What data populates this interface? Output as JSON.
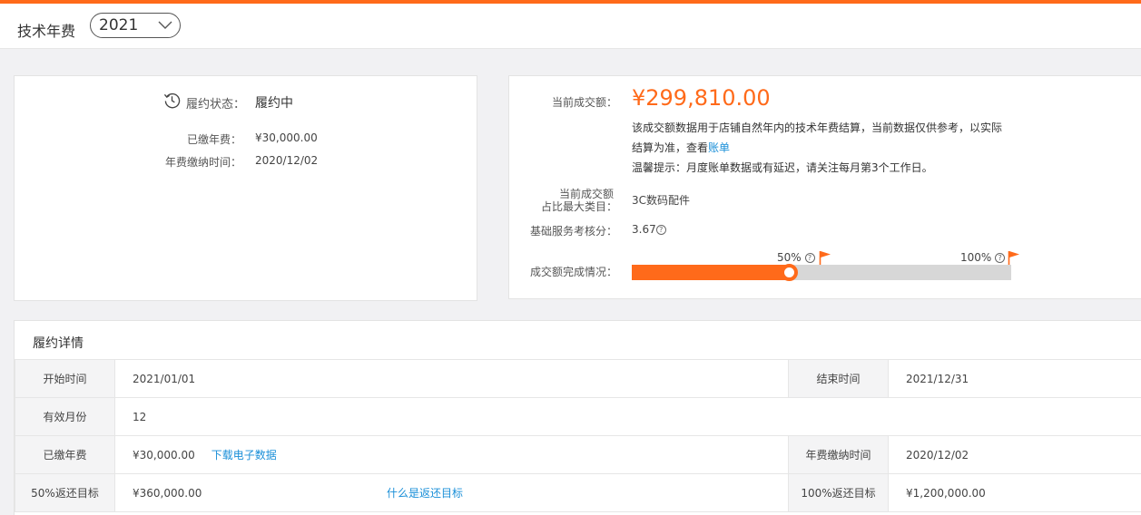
{
  "header": {
    "title": "技术年费",
    "year": "2021"
  },
  "summary": {
    "status_label": "履约状态：",
    "status_value": "履约中",
    "paid_label": "已缴年费：",
    "paid_value": "¥30,000.00",
    "pay_time_label": "年费缴纳时间：",
    "pay_time_value": "2020/12/02"
  },
  "transaction": {
    "amount_label": "当前成交额：",
    "amount_value": "¥299,810.00",
    "note_line1": "该成交额数据用于店铺自然年内的技术年费结算，当前数据仅供参考，以实际",
    "note_line2_prefix": "结算为准，查看",
    "note_link": "账单",
    "note_line3": "温馨提示：月度账单数据或有延迟，请关注每月第3个工作日。",
    "category_label_line1": "当前成交额",
    "category_label_line2": "占比最大类目：",
    "category_value": "3C数码配件",
    "score_label": "基础服务考核分：",
    "score_value": "3.67",
    "progress_label": "成交额完成情况：",
    "progress_fraction": 0.4165,
    "marker_50": "50%",
    "marker_100": "100%"
  },
  "detail": {
    "title": "履约详情",
    "rows": [
      {
        "l1": "开始时间",
        "v1": "2021/01/01",
        "l2": "结束时间",
        "v2": "2021/12/31"
      },
      {
        "l1": "有效月份",
        "v1": "12"
      },
      {
        "l1": "已缴年费",
        "v1": "¥30,000.00",
        "link1": "下载电子数据",
        "l2": "年费缴纳时间",
        "v2": "2020/12/02"
      },
      {
        "l1": "50%返还目标",
        "v1": "¥360,000.00",
        "link1": "什么是返还目标",
        "l2": "100%返还目标",
        "v2": "¥1,200,000.00"
      }
    ]
  },
  "colors": {
    "accent": "#ff6a1a",
    "link": "#1a8fd8"
  }
}
